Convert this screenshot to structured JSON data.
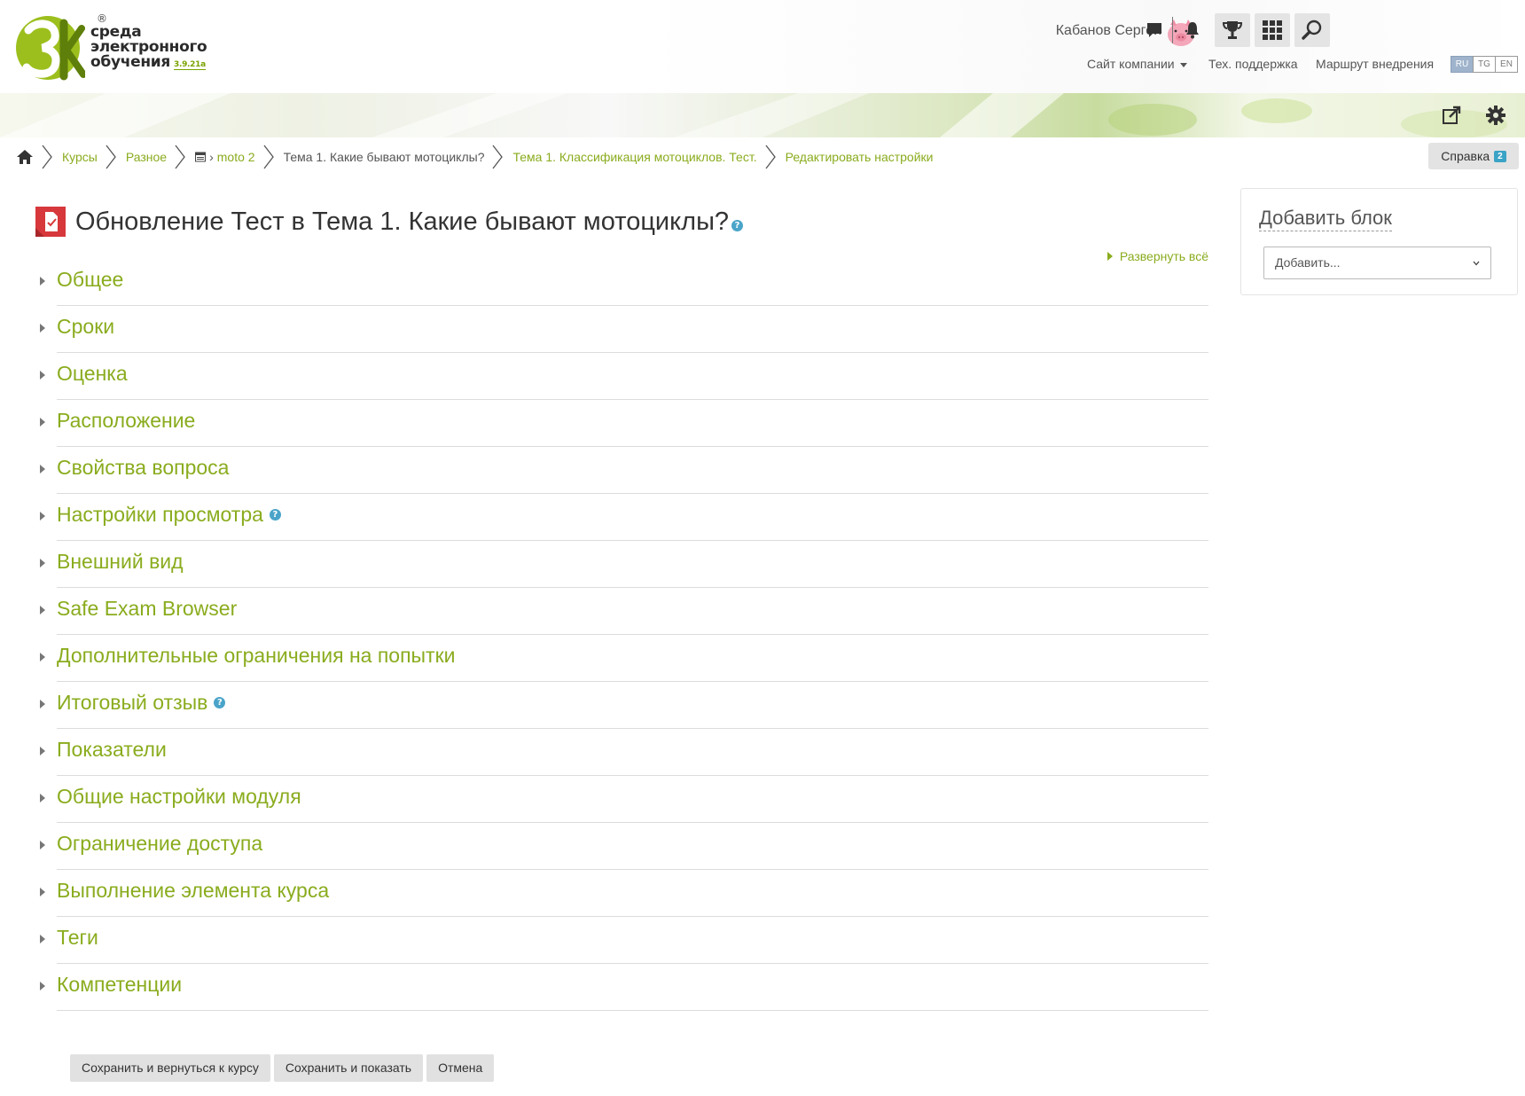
{
  "brand": {
    "line1": "среда",
    "line2": "электронного",
    "line3": "обучения",
    "version": "3.9.21a",
    "registered": "®"
  },
  "user": {
    "name": "Кабанов Сергей",
    "avatar_icon": "pig-avatar-icon"
  },
  "top_icons": [
    "messages-icon",
    "notifications-bell-icon",
    "trophy-icon",
    "apps-grid-icon",
    "search-icon"
  ],
  "top_nav": {
    "company_site": "Сайт компании",
    "tech_support": "Тех. поддержка",
    "roadmap": "Маршрут внедрения"
  },
  "languages": [
    {
      "code": "RU",
      "active": true
    },
    {
      "code": "TG",
      "active": false
    },
    {
      "code": "EN",
      "active": false
    }
  ],
  "banner_icons": [
    "send-to-icon",
    "gear-icon"
  ],
  "breadcrumb": {
    "home_icon": "home-icon",
    "items": [
      {
        "label": "Курсы"
      },
      {
        "label": "Разное"
      },
      {
        "label": "moto 2"
      },
      {
        "label": "Тема 1. Какие бывают мотоциклы?"
      },
      {
        "label": "Тема 1. Классификация мотоциклов. Тест."
      },
      {
        "label": "Редактировать настройки"
      }
    ]
  },
  "help": {
    "label": "Справка",
    "badge": "2"
  },
  "page": {
    "title": "Обновление Тест в Тема 1. Какие бывают мотоциклы?",
    "help_glyph": "?",
    "expand_all": "Развернуть всё"
  },
  "sections": [
    {
      "label": "Общее"
    },
    {
      "label": "Сроки"
    },
    {
      "label": "Оценка"
    },
    {
      "label": "Расположение"
    },
    {
      "label": "Свойства вопроса"
    },
    {
      "label": "Настройки просмотра",
      "help": true
    },
    {
      "label": "Внешний вид"
    },
    {
      "label": "Safe Exam Browser"
    },
    {
      "label": "Дополнительные ограничения на попытки"
    },
    {
      "label": "Итоговый отзыв",
      "help": true
    },
    {
      "label": "Показатели"
    },
    {
      "label": "Общие настройки модуля"
    },
    {
      "label": "Ограничение доступа"
    },
    {
      "label": "Выполнение элемента курса"
    },
    {
      "label": "Теги"
    },
    {
      "label": "Компетенции"
    }
  ],
  "actions": {
    "save_return": "Сохранить и вернуться к курсу",
    "save_display": "Сохранить и показать",
    "cancel": "Отмена"
  },
  "add_block": {
    "title": "Добавить блок",
    "select_value": "Добавить..."
  },
  "colors": {
    "accent_green": "#8aac1e",
    "quiz_red": "#d7383b",
    "help_blue": "#4aa4c9"
  }
}
